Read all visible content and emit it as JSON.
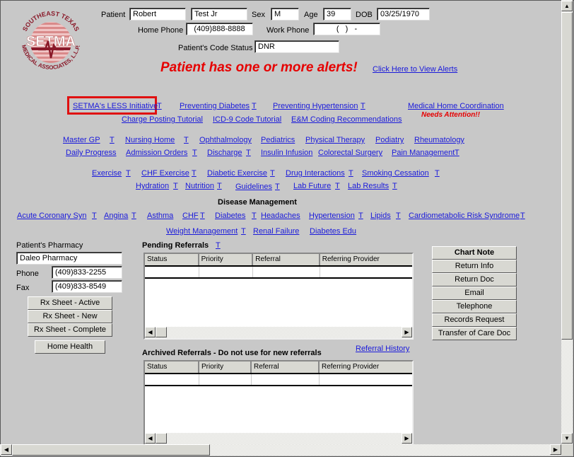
{
  "header": {
    "patient_label": "Patient",
    "first_name": "Robert",
    "last_name": "Test Jr",
    "sex_label": "Sex",
    "sex": "M",
    "age_label": "Age",
    "age": "39",
    "dob_label": "DOB",
    "dob": "03/25/1970",
    "home_phone_label": "Home Phone",
    "home_phone": "(409)888-8888",
    "work_phone_label": "Work Phone",
    "work_phone": "(   )   -",
    "code_status_label": "Patient's Code Status",
    "code_status": "DNR"
  },
  "logo": {
    "top_text": "SOUTHEAST TEXAS",
    "center_text": "SETMA",
    "bottom_text": "MEDICAL ASSOCIATES, L.L.P."
  },
  "alert": {
    "message": "Patient has one or more alerts!",
    "view_link": "Click Here to View Alerts"
  },
  "initiatives": {
    "less": "SETMA's LESS Initiative",
    "prev_diabetes": "Preventing Diabetes",
    "prev_hypertension": "Preventing Hypertension",
    "medical_home": "Medical Home Coordination",
    "needs_attention": "Needs Attention!!",
    "charge_posting": "Charge Posting Tutorial",
    "icd9": "ICD-9 Code Tutorial",
    "em_coding": "E&M Coding Recommendations",
    "t": "T"
  },
  "specialties": {
    "row1": [
      "Master GP",
      "Nursing Home",
      "Ophthalmology",
      "Pediatrics",
      "Physical Therapy",
      "Podiatry",
      "Rheumatology"
    ],
    "row2": [
      "Daily Progress",
      "Admission Orders",
      "Discharge",
      "Insulin Infusion",
      "Colorectal Surgery",
      "Pain Management"
    ]
  },
  "education": {
    "row1": [
      "Exercise",
      "CHF Exercise",
      "Diabetic Exercise",
      "Drug Interactions",
      "Smoking Cessation"
    ],
    "row2": [
      "Hydration",
      "Nutrition",
      "Guidelines",
      "Lab Future",
      "Lab Results"
    ]
  },
  "disease_management": {
    "title": "Disease Management",
    "row1": [
      "Acute Coronary Syn",
      "Angina",
      "Asthma",
      "CHF",
      "Diabetes",
      "Headaches",
      "Hypertension",
      "Lipids",
      "Cardiometabolic Risk Syndrome"
    ],
    "row2": [
      "Weight Management",
      "Renal Failure",
      "Diabetes Edu"
    ]
  },
  "pharmacy": {
    "label": "Patient's Pharmacy",
    "name": "Daleo Pharmacy",
    "phone_label": "Phone",
    "phone": "(409)833-2255",
    "fax_label": "Fax",
    "fax": "(409)833-8549",
    "buttons": [
      "Rx Sheet - Active",
      "Rx Sheet - New",
      "Rx Sheet - Complete"
    ],
    "home_health": "Home Health"
  },
  "pending_referrals": {
    "title": "Pending Referrals",
    "t": "T",
    "columns": [
      "Status",
      "Priority",
      "Referral",
      "Referring Provider"
    ]
  },
  "archived_referrals": {
    "title": "Archived Referrals - Do not use for new referrals",
    "history_link": "Referral History",
    "columns": [
      "Status",
      "Priority",
      "Referral",
      "Referring Provider"
    ]
  },
  "actions": [
    "Chart Note",
    "Return Info",
    "Return Doc",
    "Email",
    "Telephone",
    "Records Request",
    "Transfer of Care Doc"
  ],
  "icons": {
    "scroll_up": "▲",
    "scroll_down": "▼",
    "scroll_left": "◀",
    "scroll_right": "▶"
  }
}
